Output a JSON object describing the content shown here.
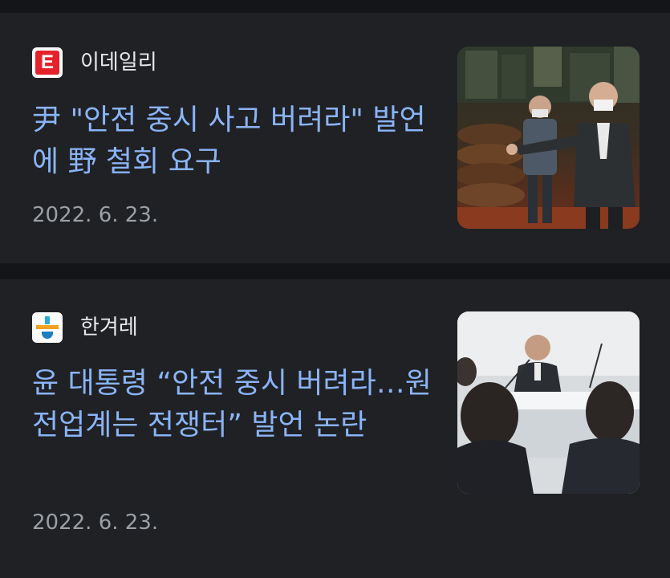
{
  "articles": [
    {
      "source": "이데일리",
      "logo_letter": "E",
      "logo_icon": "edaily-logo-icon",
      "headline": "尹 \"안전 중시 사고 버려라\" 발언에 野 철회 요구",
      "date": "2022. 6. 23.",
      "thumbnail": "photo-president-factory-visit"
    },
    {
      "source": "한겨레",
      "logo_icon": "hankyoreh-logo-icon",
      "headline": "윤 대통령 “안전 중시 버려라…원전업계는 전쟁터” 발언 논란",
      "date": "2022. 6. 23.",
      "thumbnail": "photo-president-meeting"
    }
  ],
  "colors": {
    "background": "#141518",
    "card": "#202124",
    "headline": "#8ab4f8",
    "source_text": "#e8eaed",
    "date_text": "#9aa0a6",
    "edaily_red": "#e5222b"
  }
}
